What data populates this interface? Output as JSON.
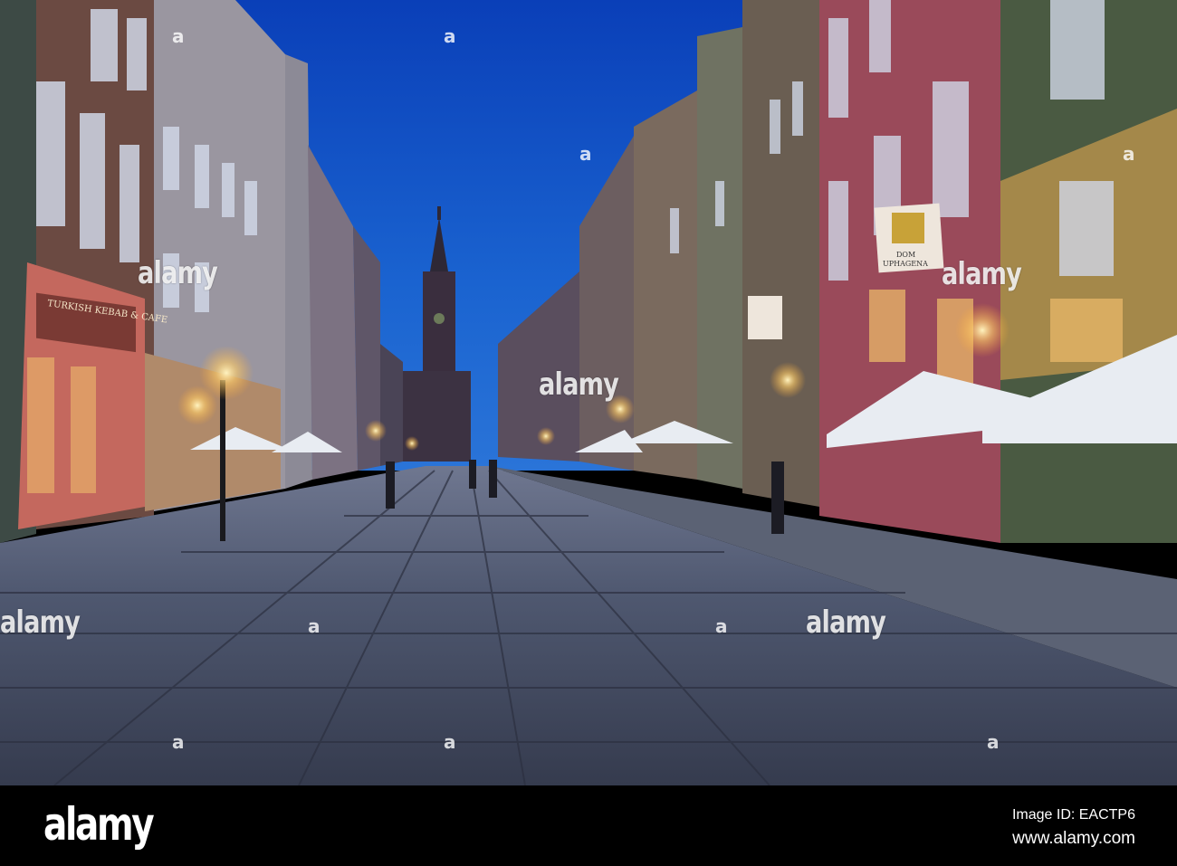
{
  "photo": {
    "signs": {
      "kebab": "TURKISH KEBAB & CAFE",
      "uphagena_line1": "DOM",
      "uphagena_line2": "UPHAGENA"
    }
  },
  "watermarks": {
    "word": "alamy",
    "letter": "a"
  },
  "footer": {
    "logo": "alamy",
    "image_id": "Image ID: EACTP6",
    "website": "www.alamy.com"
  },
  "colors": {
    "sky_top": "#0d4fc9",
    "sky_bottom": "#1e6bd6",
    "lamp": "#ffd27a"
  }
}
